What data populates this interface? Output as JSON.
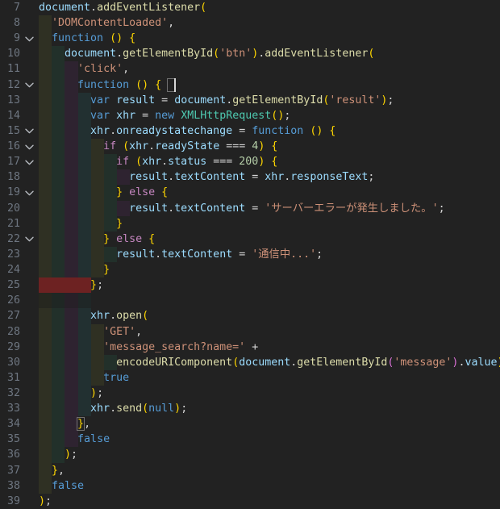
{
  "editor": {
    "language": "javascript",
    "theme": "dark-plus",
    "first_line": 7,
    "last_line": 39,
    "colors": {
      "background": "#222222",
      "line_number": "#6e7681",
      "foreground": "#d4d4d4",
      "keyword": "#569cd6",
      "control_keyword": "#c586c0",
      "variable": "#9cdcfe",
      "function_name": "#dcdcaa",
      "type_name": "#4ec9b0",
      "string": "#ce9178",
      "number": "#b5cea8",
      "row_highlight": "#6d2222",
      "indent_guide_1": "#2f3023",
      "indent_guide_2": "#22302a",
      "indent_guide_3": "#2e2330",
      "indent_guide_4": "#223031"
    },
    "icons": {
      "fold_open": "chevron-down-icon"
    },
    "lines": [
      {
        "number": "7",
        "fold": false,
        "indents": 0,
        "highlight": false,
        "blank": false,
        "text": "document.addEventListener("
      },
      {
        "number": "8",
        "fold": false,
        "indents": 1,
        "highlight": false,
        "blank": false,
        "text": "  'DOMContentLoaded',"
      },
      {
        "number": "9",
        "fold": true,
        "indents": 1,
        "highlight": false,
        "blank": false,
        "text": "  function () {"
      },
      {
        "number": "10",
        "fold": false,
        "indents": 2,
        "highlight": false,
        "blank": false,
        "text": "    document.getElementById('btn').addEventListener("
      },
      {
        "number": "11",
        "fold": false,
        "indents": 3,
        "highlight": false,
        "blank": false,
        "text": "      'click',"
      },
      {
        "number": "12",
        "fold": true,
        "indents": 3,
        "highlight": false,
        "blank": false,
        "text": "      function () {"
      },
      {
        "number": "13",
        "fold": false,
        "indents": 4,
        "highlight": false,
        "blank": false,
        "text": "        var result = document.getElementById('result');"
      },
      {
        "number": "14",
        "fold": false,
        "indents": 4,
        "highlight": false,
        "blank": false,
        "text": "        var xhr = new XMLHttpRequest();"
      },
      {
        "number": "15",
        "fold": true,
        "indents": 4,
        "highlight": false,
        "blank": false,
        "text": "        xhr.onreadystatechange = function () {"
      },
      {
        "number": "16",
        "fold": true,
        "indents": 5,
        "highlight": false,
        "blank": false,
        "text": "          if (xhr.readyState === 4) {"
      },
      {
        "number": "17",
        "fold": true,
        "indents": 6,
        "highlight": false,
        "blank": false,
        "text": "            if (xhr.status === 200) {"
      },
      {
        "number": "18",
        "fold": false,
        "indents": 7,
        "highlight": false,
        "blank": false,
        "text": "              result.textContent = xhr.responseText;"
      },
      {
        "number": "19",
        "fold": true,
        "indents": 6,
        "highlight": false,
        "blank": false,
        "text": "            } else {"
      },
      {
        "number": "20",
        "fold": false,
        "indents": 7,
        "highlight": false,
        "blank": false,
        "text": "              result.textContent = 'サーバーエラーが発生しました。';"
      },
      {
        "number": "21",
        "fold": false,
        "indents": 6,
        "highlight": false,
        "blank": false,
        "text": "            }"
      },
      {
        "number": "22",
        "fold": true,
        "indents": 5,
        "highlight": false,
        "blank": false,
        "text": "          } else {"
      },
      {
        "number": "23",
        "fold": false,
        "indents": 6,
        "highlight": false,
        "blank": false,
        "text": "            result.textContent = '通信中...';"
      },
      {
        "number": "24",
        "fold": false,
        "indents": 5,
        "highlight": false,
        "blank": false,
        "text": "          }"
      },
      {
        "number": "25",
        "fold": false,
        "indents": 4,
        "highlight": true,
        "blank": false,
        "text": "        };"
      },
      {
        "number": "26",
        "fold": false,
        "indents": 4,
        "highlight": false,
        "blank": true,
        "text": ""
      },
      {
        "number": "27",
        "fold": false,
        "indents": 4,
        "highlight": false,
        "blank": false,
        "text": "        xhr.open("
      },
      {
        "number": "28",
        "fold": false,
        "indents": 5,
        "highlight": false,
        "blank": false,
        "text": "          'GET',"
      },
      {
        "number": "29",
        "fold": false,
        "indents": 5,
        "highlight": false,
        "blank": false,
        "text": "          'message_search?name=' +"
      },
      {
        "number": "30",
        "fold": false,
        "indents": 6,
        "highlight": false,
        "blank": false,
        "text": "            encodeURIComponent(document.getElementById('message').value),"
      },
      {
        "number": "31",
        "fold": false,
        "indents": 5,
        "highlight": false,
        "blank": false,
        "text": "          true"
      },
      {
        "number": "32",
        "fold": false,
        "indents": 4,
        "highlight": false,
        "blank": false,
        "text": "        );"
      },
      {
        "number": "33",
        "fold": false,
        "indents": 4,
        "highlight": false,
        "blank": false,
        "text": "        xhr.send(null);"
      },
      {
        "number": "34",
        "fold": false,
        "indents": 3,
        "highlight": false,
        "blank": false,
        "text": "      },"
      },
      {
        "number": "35",
        "fold": false,
        "indents": 3,
        "highlight": false,
        "blank": false,
        "text": "      false"
      },
      {
        "number": "36",
        "fold": false,
        "indents": 2,
        "highlight": false,
        "blank": false,
        "text": "    );"
      },
      {
        "number": "37",
        "fold": false,
        "indents": 1,
        "highlight": false,
        "blank": false,
        "text": "  },"
      },
      {
        "number": "38",
        "fold": false,
        "indents": 1,
        "highlight": false,
        "blank": false,
        "text": "  false"
      },
      {
        "number": "39",
        "fold": false,
        "indents": 0,
        "highlight": false,
        "blank": false,
        "text": ");"
      }
    ],
    "cursor": {
      "line": "12",
      "column": 21
    },
    "bracket_matches": [
      {
        "line": "12",
        "column": 20,
        "char": "{"
      },
      {
        "line": "34",
        "column": 6,
        "char": "}"
      }
    ]
  }
}
